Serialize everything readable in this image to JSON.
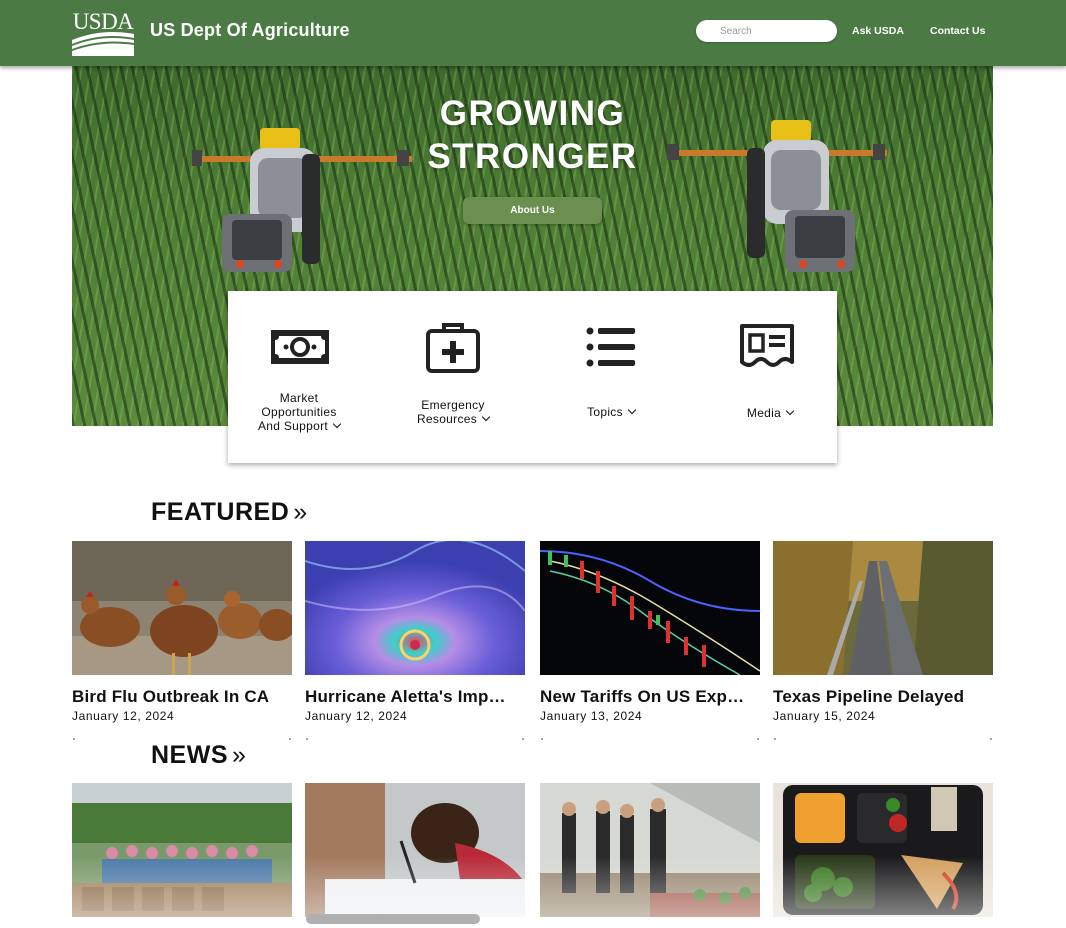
{
  "header": {
    "logo_text": "USDA",
    "agency_name": "US Dept Of Agriculture",
    "search_placeholder": "Search",
    "search_value": "",
    "nav": [
      {
        "label": "Ask USDA"
      },
      {
        "label": "Contact Us"
      }
    ],
    "background_color": "#4b7a45"
  },
  "hero": {
    "title_line1": "GROWING",
    "title_line2": "STRONGER",
    "button_label": "About Us",
    "image_subject": "aerial view of corn field with two tractors"
  },
  "quick_links": [
    {
      "label": "Market\nOpportunities\nAnd Support",
      "icon": "money-icon"
    },
    {
      "label": "Emergency\nResources",
      "icon": "first-aid-kit-icon"
    },
    {
      "label": "Topics",
      "icon": "list-icon"
    },
    {
      "label": "Media",
      "icon": "newspaper-icon"
    }
  ],
  "featured": {
    "heading": "FEATURED",
    "arrow_glyph": "»",
    "items": [
      {
        "title": "Bird Flu Outbreak In CA",
        "date": "January 12, 2024",
        "image": "chickens"
      },
      {
        "title": "Hurricane Aletta's Imp…",
        "date": "January 12, 2024",
        "image": "hurricane satellite map"
      },
      {
        "title": "New Tariffs On US Exp…",
        "date": "January 13, 2024",
        "image": "stock chart"
      },
      {
        "title": "Texas Pipeline Delayed",
        "date": "January 15, 2024",
        "image": "pipeline in forest"
      }
    ]
  },
  "news": {
    "heading": "NEWS",
    "arrow_glyph": "»",
    "items": [
      {
        "image": "volunteers with food bags"
      },
      {
        "image": "student writing"
      },
      {
        "image": "people at community garden"
      },
      {
        "image": "school lunch tray"
      }
    ]
  },
  "colors": {
    "brand_green": "#4b7a45",
    "button_green": "#6a8f4e"
  }
}
